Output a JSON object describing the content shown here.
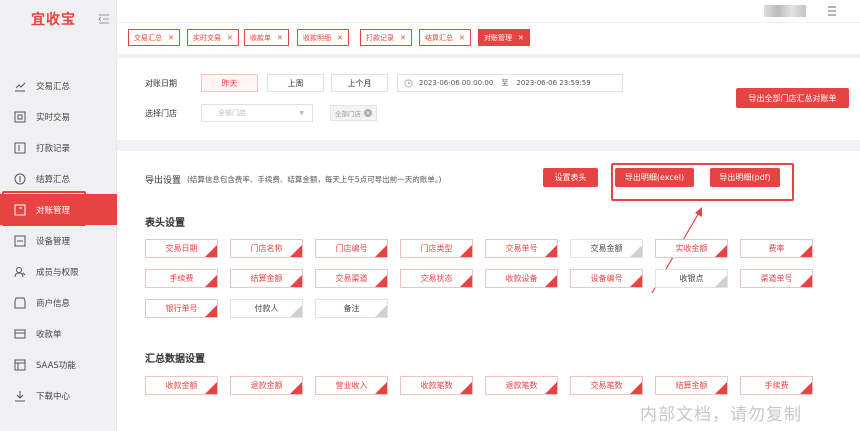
{
  "app": {
    "title": "宜收宝"
  },
  "sidebar": {
    "items": [
      {
        "label": "交易汇总",
        "icon": "trend-chart-icon"
      },
      {
        "label": "实时交易",
        "icon": "realtime-icon"
      },
      {
        "label": "打款记录",
        "icon": "payment-record-icon"
      },
      {
        "label": "结算汇总",
        "icon": "settlement-icon"
      },
      {
        "label": "对账管理",
        "icon": "reconcile-icon",
        "active": true
      },
      {
        "label": "设备管理",
        "icon": "device-icon"
      },
      {
        "label": "成员与权限",
        "icon": "member-icon"
      },
      {
        "label": "商户信息",
        "icon": "merchant-icon"
      },
      {
        "label": "收款单",
        "icon": "receipt-icon"
      },
      {
        "label": "SAAS功能",
        "icon": "saas-icon"
      },
      {
        "label": "下载中心",
        "icon": "download-icon"
      }
    ]
  },
  "tabs": [
    {
      "label": "交易汇总"
    },
    {
      "label": "实时交易"
    },
    {
      "label": "收款单"
    },
    {
      "label": "收款明细"
    },
    {
      "label": "打款记录"
    },
    {
      "label": "结算汇总"
    },
    {
      "label": "对账管理",
      "active": true
    }
  ],
  "filter": {
    "date_label": "对账日期",
    "date_options": [
      "昨天",
      "上周",
      "上个月"
    ],
    "date_selected": "昨天",
    "date_start": "2023-06-06 00:00:00",
    "date_sep": "至",
    "date_end": "2023-06-06 23:59:59",
    "store_label": "选择门店",
    "store_placeholder": "全部门店",
    "store_chip": "全部门店",
    "export_all_button": "导出全部门店汇总对账单"
  },
  "export": {
    "title": "导出设置",
    "note": "(结算信息包含费率、手续费、结算金额，每天上午5点可导出前一天的账单。)",
    "set_header_button": "设置表头",
    "export_excel_button": "导出明细(excel)",
    "export_pdf_button": "导出明细(pdf)"
  },
  "header_settings": {
    "title": "表头设置",
    "fields": [
      {
        "label": "交易日期",
        "on": true
      },
      {
        "label": "门店名称",
        "on": true
      },
      {
        "label": "门店编号",
        "on": true
      },
      {
        "label": "门店类型",
        "on": true
      },
      {
        "label": "交易单号",
        "on": true
      },
      {
        "label": "交易金额",
        "on": false
      },
      {
        "label": "实收金额",
        "on": true
      },
      {
        "label": "费率",
        "on": true
      },
      {
        "label": "手续费",
        "on": true
      },
      {
        "label": "结算金额",
        "on": true
      },
      {
        "label": "交易渠道",
        "on": true
      },
      {
        "label": "交易状态",
        "on": true
      },
      {
        "label": "收款设备",
        "on": true
      },
      {
        "label": "设备编号",
        "on": true
      },
      {
        "label": "收银点",
        "on": false
      },
      {
        "label": "渠道单号",
        "on": true
      },
      {
        "label": "银行单号",
        "on": true
      },
      {
        "label": "付款人",
        "on": false
      },
      {
        "label": "备注",
        "on": false
      }
    ]
  },
  "summary_settings": {
    "title": "汇总数据设置",
    "fields": [
      {
        "label": "收款金额",
        "on": true
      },
      {
        "label": "退款金额",
        "on": true
      },
      {
        "label": "营业收入",
        "on": true
      },
      {
        "label": "收款笔数",
        "on": true
      },
      {
        "label": "退款笔数",
        "on": true
      },
      {
        "label": "交易笔数",
        "on": true
      },
      {
        "label": "结算金额",
        "on": true
      },
      {
        "label": "手续费",
        "on": true
      }
    ]
  },
  "watermark": "内部文档，请勿复制",
  "colors": {
    "accent": "#e84343"
  }
}
